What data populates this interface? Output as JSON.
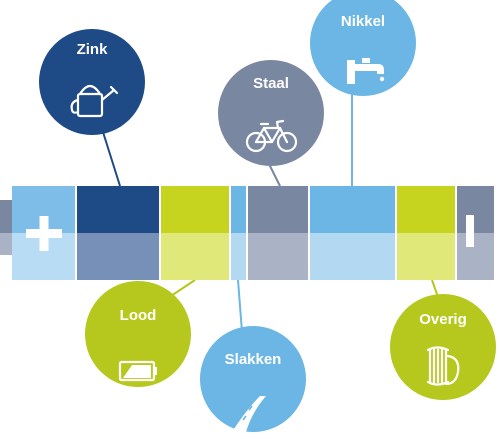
{
  "battery": {
    "plus_sign": "+",
    "minus_sign": "−"
  },
  "metals": [
    {
      "label": "Zink",
      "icon": "watering-can-icon",
      "color": "#1e4a86"
    },
    {
      "label": "Staal",
      "icon": "bicycle-icon",
      "color": "#7a87a1"
    },
    {
      "label": "Nikkel",
      "icon": "faucet-icon",
      "color": "#6bb6e4"
    },
    {
      "label": "Lood",
      "icon": "battery-icon",
      "color": "#b6c81d"
    },
    {
      "label": "Slakken",
      "icon": "road-icon",
      "color": "#6bb6e4"
    },
    {
      "label": "Overig",
      "icon": "coil-icon",
      "color": "#b6c81d"
    }
  ]
}
